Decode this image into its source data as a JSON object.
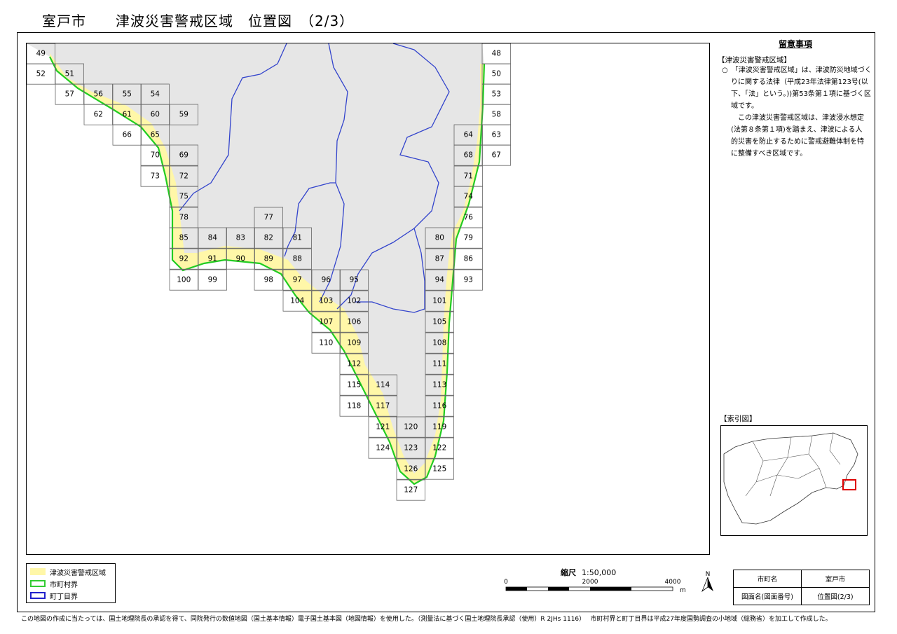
{
  "title": "室戸市　　津波災害警戒区域　位置図　（2/3）",
  "notes": {
    "title": "留意事項",
    "section": "【津波災害警戒区域】",
    "p1": "○　「津波災害警戒区域」は、津波防災地域づくりに関する法律（平成23年法律第123号(以下、「法」という。))第53条第１項に基づく区域です。",
    "p2": "この津波災害警戒区域は、津波浸水想定(法第８条第１項)を踏まえ、津波による人的災害を防止するために警戒避難体制を特に整備すべき区域です。"
  },
  "index_map": {
    "title": "【索引図】"
  },
  "legend": [
    {
      "label": "津波災害警戒区域",
      "color": "#fff7a8",
      "style": "fill"
    },
    {
      "label": "市町村界",
      "color": "#33cc33",
      "style": "outline"
    },
    {
      "label": "町丁目界",
      "color": "#2222cc",
      "style": "outline"
    }
  ],
  "scale": {
    "label": "縮尺",
    "ratio": "1:50,000",
    "ticks": [
      "0",
      "2000",
      "4000"
    ],
    "unit": "m"
  },
  "north": "N",
  "info_table": {
    "city_label": "市町名",
    "city_value": "室戸市",
    "sheet_label": "図面名(図面番号)",
    "sheet_value": "位置図(2/3)"
  },
  "footnote": "この地図の作成に当たっては、国土地理院長の承認を得て、同院発行の数値地図（国土基本情報）電子国土基本図（地図情報）を使用した。（測量法に基づく国土地理院長承認（使用）R 2JHs 1116）　 市町村界と町丁目界は平成27年度国勢調査の小地域（総務省）を加工して作成した。",
  "tiles": [
    "49",
    "52",
    "51",
    "57",
    "56",
    "55",
    "54",
    "62",
    "61",
    "60",
    "59",
    "66",
    "65",
    "70",
    "69",
    "73",
    "72",
    "75",
    "78",
    "77",
    "85",
    "84",
    "83",
    "82",
    "81",
    "92",
    "91",
    "90",
    "89",
    "88",
    "100",
    "99",
    "98",
    "97",
    "96",
    "95",
    "104",
    "103",
    "102",
    "107",
    "106",
    "110",
    "109",
    "112",
    "115",
    "114",
    "118",
    "117",
    "121",
    "120",
    "124",
    "123",
    "126",
    "125",
    "127",
    "48",
    "50",
    "53",
    "58",
    "64",
    "63",
    "68",
    "67",
    "71",
    "74",
    "76",
    "80",
    "79",
    "87",
    "86",
    "94",
    "93",
    "101",
    "105",
    "108",
    "111",
    "113",
    "116",
    "119",
    "122"
  ],
  "colors": {
    "tsunami": "#fff7a8",
    "boundary": "#22cc22",
    "town": "#3344cc",
    "index_highlight": "#dd0000"
  }
}
